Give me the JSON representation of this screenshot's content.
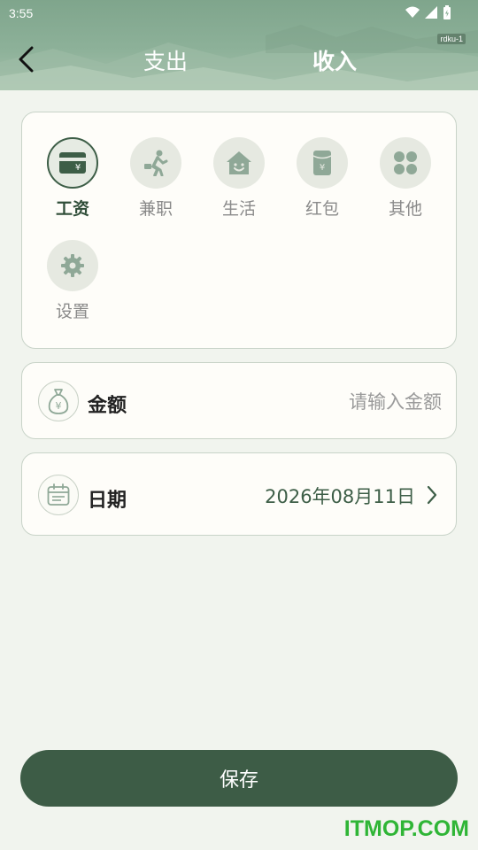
{
  "status_bar": {
    "time": "3:55",
    "icons": [
      "wifi-icon",
      "signal-icon",
      "battery-icon"
    ]
  },
  "header": {
    "debug_tag": "rdku-1",
    "back_icon": "chevron-left-icon",
    "tabs": [
      {
        "label": "支出",
        "active": false
      },
      {
        "label": "收入",
        "active": true
      }
    ]
  },
  "categories": [
    {
      "label": "工资",
      "icon": "wallet-card-icon",
      "selected": true
    },
    {
      "label": "兼职",
      "icon": "running-person-icon",
      "selected": false
    },
    {
      "label": "生活",
      "icon": "house-smile-icon",
      "selected": false
    },
    {
      "label": "红包",
      "icon": "red-envelope-icon",
      "selected": false
    },
    {
      "label": "其他",
      "icon": "four-leaf-icon",
      "selected": false
    },
    {
      "label": "设置",
      "icon": "gear-icon",
      "selected": false
    }
  ],
  "amount": {
    "label": "金额",
    "icon": "money-bag-icon",
    "value": "",
    "placeholder": "请输入金额"
  },
  "date": {
    "label": "日期",
    "icon": "calendar-icon",
    "value": "2026年08月11日",
    "chevron_icon": "chevron-right-icon"
  },
  "save_button": {
    "label": "保存"
  },
  "watermark": "ITMOP.COM",
  "colors": {
    "accent": "#3d5c46",
    "background": "#f1f4ee",
    "card": "#fefdf9",
    "header": "#8db199",
    "icon_muted": "#8fa897"
  }
}
